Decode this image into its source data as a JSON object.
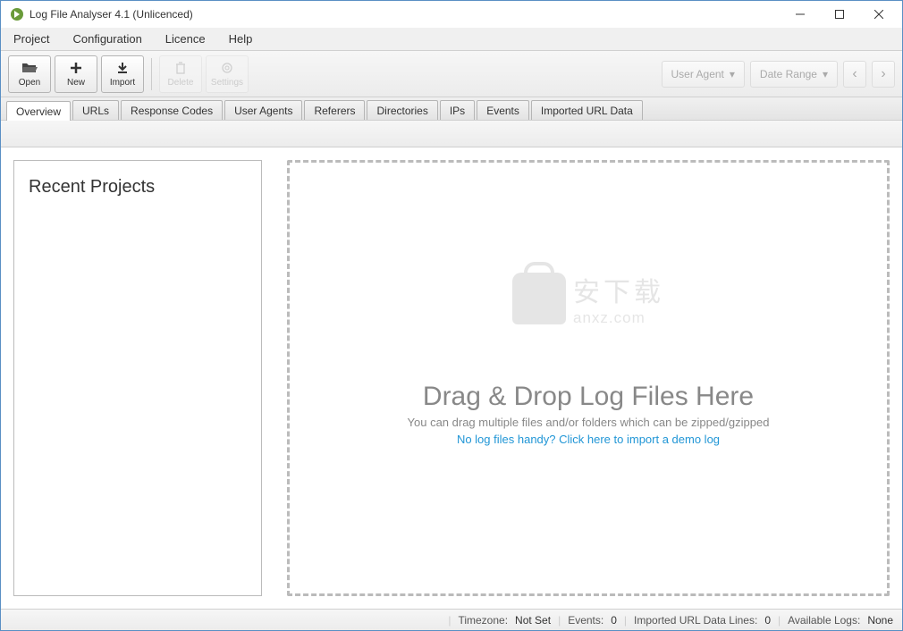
{
  "window": {
    "title": "Log File Analyser 4.1 (Unlicenced)"
  },
  "menu": {
    "project": "Project",
    "configuration": "Configuration",
    "licence": "Licence",
    "help": "Help"
  },
  "toolbar": {
    "open": "Open",
    "new": "New",
    "import": "Import",
    "delete": "Delete",
    "settings": "Settings",
    "user_agent": "User Agent",
    "date_range": "Date Range"
  },
  "tabs": {
    "overview": "Overview",
    "urls": "URLs",
    "response_codes": "Response Codes",
    "user_agents": "User Agents",
    "referers": "Referers",
    "directories": "Directories",
    "ips": "IPs",
    "events": "Events",
    "imported_url_data": "Imported URL Data"
  },
  "recent": {
    "title": "Recent Projects"
  },
  "watermark": {
    "cn": "安下载",
    "en": "anxz.com"
  },
  "drop": {
    "title": "Drag & Drop Log Files Here",
    "sub": "You can drag multiple files and/or folders which can be zipped/gzipped",
    "link": "No log files handy? Click here to import a demo log"
  },
  "status": {
    "timezone_label": "Timezone:",
    "timezone_val": "Not Set",
    "events_label": "Events:",
    "events_val": "0",
    "imported_label": "Imported URL Data Lines:",
    "imported_val": "0",
    "available_label": "Available Logs:",
    "available_val": "None"
  }
}
